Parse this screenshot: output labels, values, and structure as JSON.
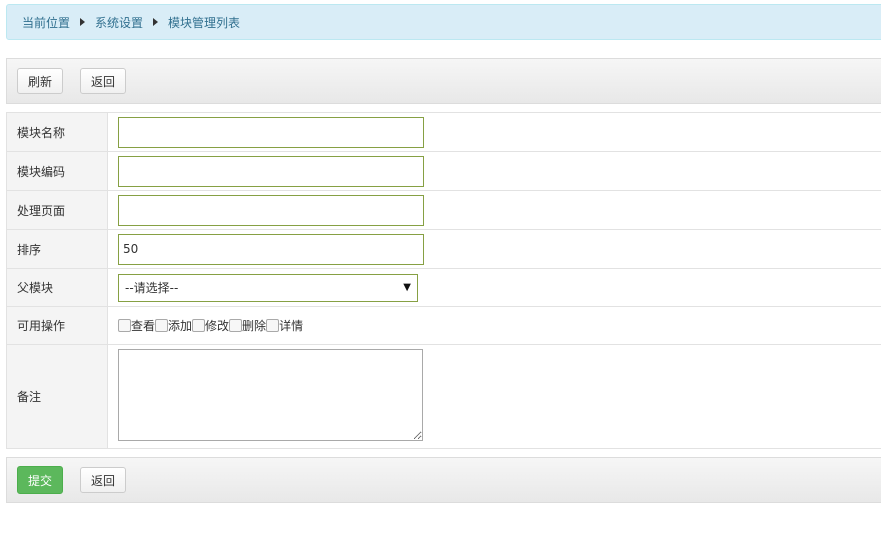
{
  "breadcrumb": {
    "items": [
      "当前位置",
      "系统设置",
      "模块管理列表"
    ]
  },
  "toolbar_top": {
    "refresh_label": "刷新",
    "back_label": "返回"
  },
  "form": {
    "fields": [
      {
        "label": "模块名称",
        "value": "",
        "placeholder": ""
      },
      {
        "label": "模块编码",
        "value": "",
        "placeholder": ""
      },
      {
        "label": "处理页面",
        "value": "",
        "placeholder": ""
      },
      {
        "label": "排序",
        "value": "50",
        "placeholder": ""
      }
    ],
    "parent": {
      "label": "父模块",
      "selected": "--请选择--"
    },
    "operations": {
      "label": "可用操作",
      "options": [
        "查看",
        "添加",
        "修改",
        "删除",
        "详情"
      ],
      "checked": [
        false,
        false,
        false,
        false,
        false
      ]
    },
    "note": {
      "label": "备注",
      "value": ""
    }
  },
  "toolbar_bottom": {
    "submit_label": "提交",
    "back_label": "返回"
  },
  "colors": {
    "breadcrumb_bg": "#d9edf7",
    "submit": "#5cb85c",
    "input_border": "#86a043"
  }
}
